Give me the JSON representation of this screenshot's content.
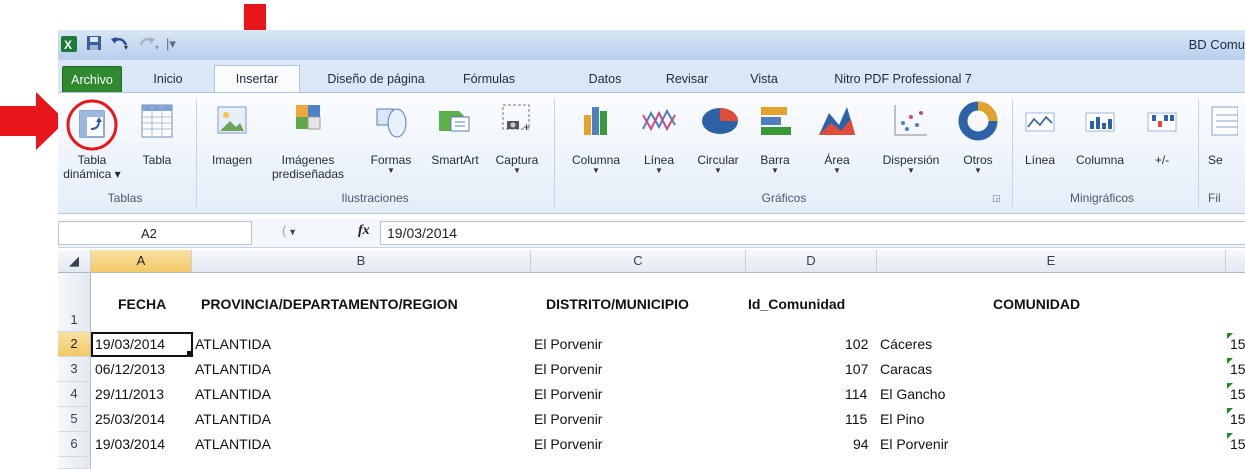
{
  "app_title": "BD Comu",
  "quick_access": {
    "save_icon": "save-icon",
    "undo_icon": "undo-icon",
    "redo_icon": "redo-icon"
  },
  "tabs": [
    "Archivo",
    "Inicio",
    "Insertar",
    "Diseño de página",
    "Fórmulas",
    "Datos",
    "Revisar",
    "Vista",
    "Nitro PDF Professional 7"
  ],
  "active_tab": "Insertar",
  "ribbon": {
    "tablas": {
      "label": "Tablas",
      "tabla_dinamica": [
        "Tabla",
        "dinámica ▾"
      ],
      "tabla": "Tabla"
    },
    "ilustraciones": {
      "label": "Ilustraciones",
      "imagen": "Imagen",
      "imagenes": [
        "Imágenes",
        "prediseñadas"
      ],
      "formas": "Formas",
      "smartart": "SmartArt",
      "captura": "Captura"
    },
    "graficos": {
      "label": "Gráficos",
      "columna": "Columna",
      "linea": "Línea",
      "circular": "Circular",
      "barra": "Barra",
      "area": "Área",
      "dispersion": "Dispersión",
      "otros": "Otros"
    },
    "minigraficos": {
      "label": "Minigráficos",
      "linea": "Línea",
      "columna": "Columna",
      "ganancia": "+/-"
    },
    "filtro": {
      "label": "Fil",
      "segmentacion": "Se"
    }
  },
  "formula_bar": {
    "name_box": "A2",
    "fx": "fx",
    "value": "19/03/2014"
  },
  "columns": [
    "A",
    "B",
    "C",
    "D",
    "E"
  ],
  "rows": [
    "1",
    "2",
    "3",
    "4",
    "5",
    "6"
  ],
  "headers": {
    "a": "FECHA",
    "b": "PROVINCIA/DEPARTAMENTO/REGION",
    "c": "DISTRITO/MUNICIPIO",
    "d": "Id_Comunidad",
    "e": "COMUNIDAD"
  },
  "data_rows": [
    {
      "fecha": "19/03/2014",
      "provincia": "ATLANTIDA",
      "distrito": "El Porvenir",
      "id": "102",
      "comunidad": "Cáceres",
      "f": "15"
    },
    {
      "fecha": "06/12/2013",
      "provincia": "ATLANTIDA",
      "distrito": "El Porvenir",
      "id": "107",
      "comunidad": "Caracas",
      "f": "15"
    },
    {
      "fecha": "29/11/2013",
      "provincia": "ATLANTIDA",
      "distrito": "El Porvenir",
      "id": "114",
      "comunidad": "El Gancho",
      "f": "15"
    },
    {
      "fecha": "25/03/2014",
      "provincia": "ATLANTIDA",
      "distrito": "El Porvenir",
      "id": "115",
      "comunidad": "El Pino",
      "f": "15"
    },
    {
      "fecha": "19/03/2014",
      "provincia": "ATLANTIDA",
      "distrito": "El Porvenir",
      "id": "94",
      "comunidad": "El Porvenir",
      "f": "15"
    }
  ],
  "colors": {
    "annotation_red": "#e8151b",
    "archivo_green": "#2f8a2f",
    "selected_header": "#f3c865"
  }
}
